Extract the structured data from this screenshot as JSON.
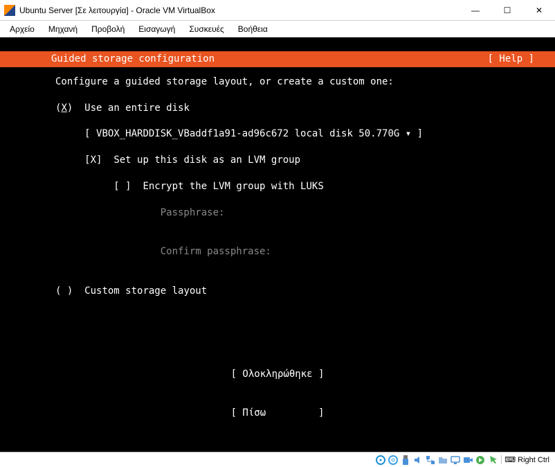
{
  "window": {
    "title": "Ubuntu Server [Σε λειτουργία] - Oracle VM VirtualBox"
  },
  "menu": {
    "file": "Αρχείο",
    "machine": "Μηχανή",
    "view": "Προβολή",
    "input": "Εισαγωγή",
    "devices": "Συσκευές",
    "help": "Βοήθεια"
  },
  "installer": {
    "header_title": "Guided storage configuration",
    "help_label": "[ Help ]",
    "intro": "Configure a guided storage layout, or create a custom one:",
    "radio_entire": {
      "mark": "(X)",
      "label": "Use an entire disk",
      "mark_inner": "X"
    },
    "disk_selector": "[ VBOX_HARDDISK_VBaddf1a91-ad96c672 local disk 50.770G ▾ ]",
    "check_lvm": {
      "mark": "[X]",
      "label": "Set up this disk as an LVM group"
    },
    "check_luks": {
      "mark": "[ ]",
      "label": "Encrypt the LVM group with LUKS"
    },
    "passphrase_label": "Passphrase:",
    "confirm_label": "Confirm passphrase:",
    "radio_custom": {
      "mark": "( )",
      "label": "Custom storage layout"
    },
    "done_button": "[ Ολοκληρώθηκε ]",
    "back_button": "[ Πίσω         ]"
  },
  "status": {
    "hostkey": "Right Ctrl"
  }
}
